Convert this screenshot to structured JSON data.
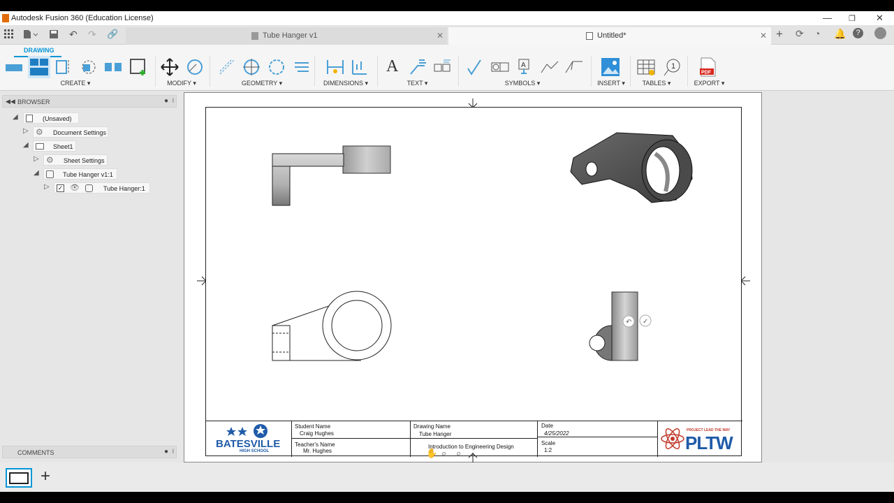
{
  "window": {
    "title": "Autodesk Fusion 360 (Education License)"
  },
  "tabs": [
    {
      "label": "Tube Hanger v1",
      "active": false
    },
    {
      "label": "Untitled*",
      "active": true
    }
  ],
  "workspace": "DRAWING",
  "ribbon_groups": [
    "CREATE ▾",
    "MODIFY ▾",
    "GEOMETRY ▾",
    "DIMENSIONS ▾",
    "TEXT ▾",
    "SYMBOLS ▾",
    "INSERT ▾",
    "TABLES ▾",
    "EXPORT ▾"
  ],
  "browser": {
    "title": "BROWSER",
    "nodes": [
      "(Unsaved)",
      "Document Settings",
      "Sheet1",
      "Sheet Settings",
      "Tube Hanger v1:1",
      "Tube Hanger:1"
    ]
  },
  "comments": {
    "title": "COMMENTS"
  },
  "title_block": {
    "school_name": "BATESVILLE",
    "school_sub": "HIGH SCHOOL",
    "student_label": "Student Name",
    "student_value": "Craig Hughes",
    "teacher_label": "Teacher's Name",
    "teacher_value": "Mr. Hughes",
    "drawing_label": "Drawing Name",
    "drawing_value": "Tube Hanger",
    "course_value": "Introduction to Engineering Design",
    "date_label": "Date",
    "date_value": "4/25/2022",
    "scale_label": "Scale",
    "scale_value": "1:2",
    "brand": "PLTW",
    "brand_sub": "PROJECT LEAD THE WAY"
  },
  "colors": {
    "accent": "#0696d7",
    "brand_red": "#c0392b",
    "brand_blue": "#1f5ba8"
  }
}
